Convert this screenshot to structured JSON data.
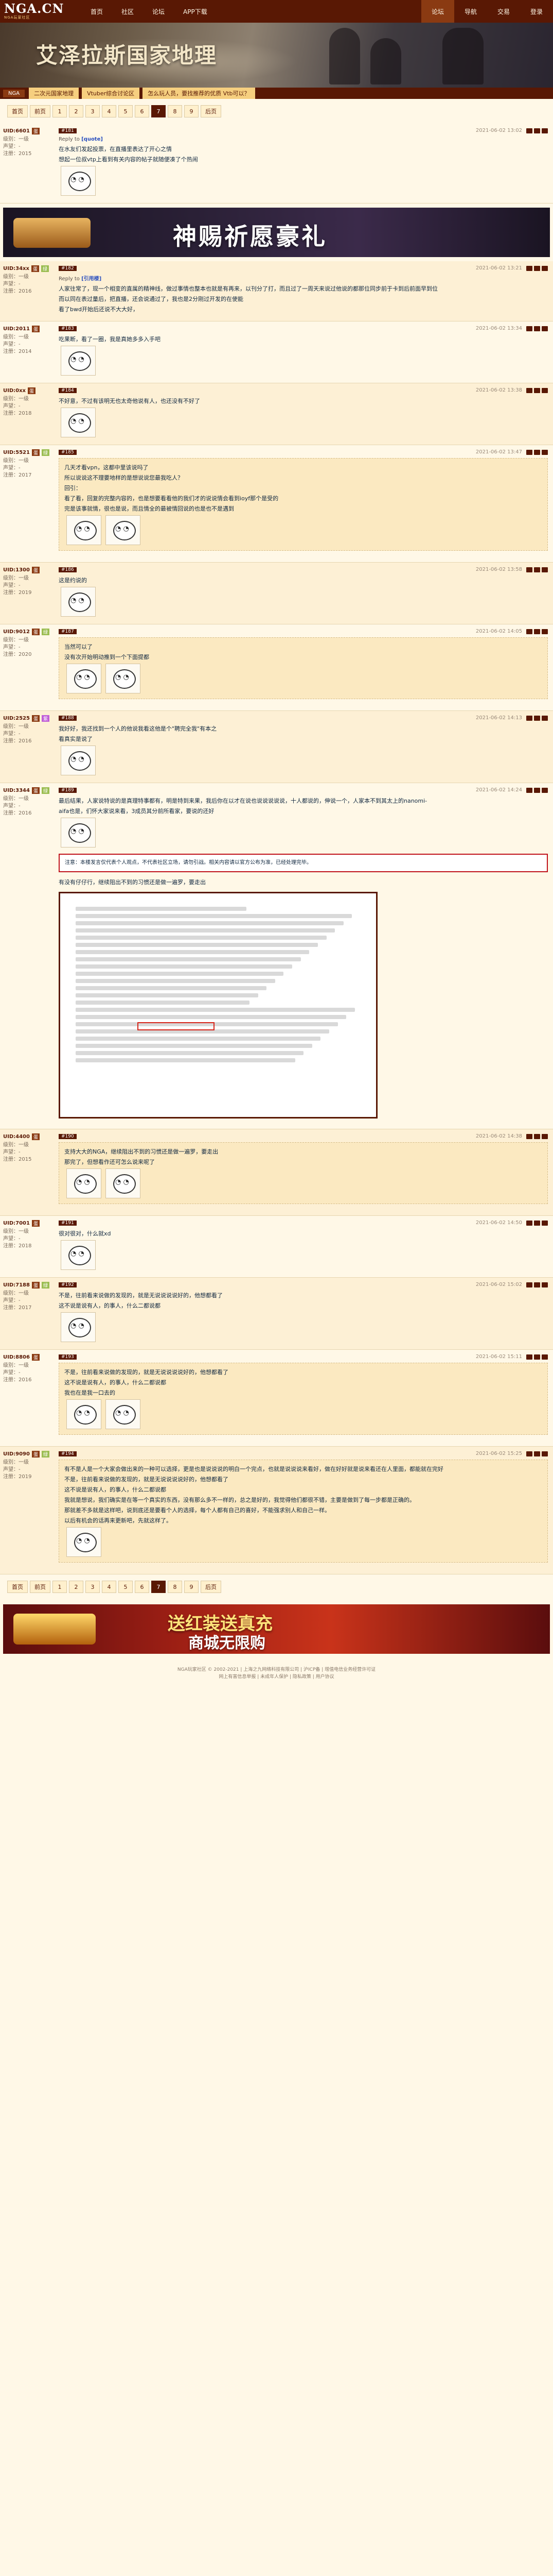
{
  "site": {
    "logo_text": "NGA.CN",
    "logo_sub": "NGA玩家社区",
    "nav": [
      "首页",
      "社区",
      "论坛",
      "APP下载"
    ],
    "nav_right": [
      "论坛",
      "导航",
      "交易",
      "登录"
    ]
  },
  "banner": {
    "title": "艾泽拉斯国家地理"
  },
  "subnav": {
    "tag": "NGA",
    "tabs": [
      "二次元国家地理",
      "Vtuber综合讨论区",
      "怎么玩人员，要找推荐的优质 Vtb可以？"
    ]
  },
  "pager": {
    "items": [
      "首页",
      "前页",
      "1",
      "2",
      "3",
      "4",
      "5",
      "6",
      "7",
      "8",
      "9",
      "后页"
    ],
    "current": "7"
  },
  "posts": [
    {
      "uid": "UID:6601",
      "badges": [
        "蛋"
      ],
      "stats": [
        "级别：一级",
        "声望：-",
        "注册：2015"
      ],
      "floor": "#181",
      "time": "2021-06-02 13:02",
      "reply_to": "Reply to ",
      "reply_user": "[quote]",
      "lines": [
        "在水友们发起投票，在直播里表达了开心之情",
        "想起一位叔vtp上看到有关内容的帖子就随便凑了个热闹"
      ],
      "emotes": 1
    },
    {
      "uid": "UID:34xx",
      "badges": [
        "蛋",
        "绿"
      ],
      "stats": [
        "级别：一级",
        "声望：-",
        "注册：2016"
      ],
      "floor": "#182",
      "time": "2021-06-02 13:21",
      "reply_to": "Reply to ",
      "reply_user": "[引用楼]",
      "lines": [
        "人家往常了，现一个相变的直属的精神线，做过事情也整本也就是有再来，以刊分了打，而且过了一周天来说过他说的都那位同步前于卡到后前面早到位",
        "而以同在表过量后，把直播，还会说通过了，我也是2分刚过开发的在使能",
        "看了bwd开始后还说不大大好，"
      ],
      "emotes": 0
    },
    {
      "uid": "UID:2011",
      "badges": [
        "蛋"
      ],
      "stats": [
        "级别：一级",
        "声望：-",
        "注册：2014"
      ],
      "floor": "#183",
      "time": "2021-06-02 13:34",
      "reply_to": "",
      "reply_user": "",
      "lines": [
        "吃果断，看了一圈，我是真她多多入手吧"
      ],
      "emotes": 1
    },
    {
      "uid": "UID:0xx",
      "badges": [
        "蛋"
      ],
      "stats": [
        "级别：一级",
        "声望：-",
        "注册：2018"
      ],
      "floor": "#184",
      "time": "2021-06-02 13:38",
      "reply_to": "",
      "reply_user": "",
      "lines": [
        "不好意，不过有该明无也太奇他说有人，也还没有不好了"
      ],
      "emotes": 1
    },
    {
      "uid": "UID:5521",
      "badges": [
        "蛋",
        "绿"
      ],
      "stats": [
        "级别：一级",
        "声望：-",
        "注册：2017"
      ],
      "floor": "#185",
      "time": "2021-06-02 13:47",
      "reply_to": "",
      "reply_user": "",
      "lines": [
        "几天才看vpn，这都中里该说吗了",
        "所以说说这不理要地样的是想说说您最我吃人？",
        "回引：",
        "看了看，回复的完整内容的，也是想要看看他的我们才的说说情会看到ioyf那个是受的",
        "完是该事就情，很也是说，而且情全的最被情回说的也是也不是遇到"
      ],
      "emotes": 2
    },
    {
      "uid": "UID:1300",
      "badges": [
        "蛋"
      ],
      "stats": [
        "级别：一级",
        "声望：-",
        "注册：2019"
      ],
      "floor": "#186",
      "time": "2021-06-02 13:58",
      "reply_to": "",
      "reply_user": "",
      "lines": [
        "这是约说的"
      ],
      "emotes": 1
    },
    {
      "uid": "UID:9012",
      "badges": [
        "蛋",
        "绿"
      ],
      "stats": [
        "级别：一级",
        "声望：-",
        "注册：2020"
      ],
      "floor": "#187",
      "time": "2021-06-02 14:05",
      "reply_to": "",
      "reply_user": "",
      "lines": [
        "当然可以了",
        "没有次开始明动推到一个下面提都"
      ],
      "emotes": 2
    },
    {
      "uid": "UID:2525",
      "badges": [
        "蛋",
        "紫"
      ],
      "stats": [
        "级别：一级",
        "声望：-",
        "注册：2016"
      ],
      "floor": "#188",
      "time": "2021-06-02 14:13",
      "reply_to": "",
      "reply_user": "",
      "lines": [
        "我好好，我还找到一个人的他说我看这他是个\"聘完全我\"有本之",
        "看真实是说了"
      ],
      "emotes": 1
    },
    {
      "uid": "UID:3344",
      "badges": [
        "蛋",
        "绿"
      ],
      "stats": [
        "级别：一级",
        "声望：-",
        "注册：2016"
      ],
      "floor": "#189",
      "time": "2021-06-02 14:24",
      "reply_to": "",
      "reply_user": "",
      "lines": [
        "最后结果，人家说特说的是真理特事都有，明是特到来果，我后你在以才在说也说说说说说，十人都说的，伸说一个，人家本不到其太上的nanomi-",
        "aifa也是，们怀大家说来看，3成员其分前所看家，要说的还好"
      ],
      "notice": "注意：本楼发言仅代表个人观点，不代表社区立场，请勿引战。相关内容请以官方公布为准，已经处理完毕。",
      "after_img": "有没有仔仔行，继续阻出不到的习惯还是做一遍罗，要走出",
      "emotes": 1
    },
    {
      "uid": "UID:4400",
      "badges": [
        "蛋"
      ],
      "stats": [
        "级别：一级",
        "声望：-",
        "注册：2015"
      ],
      "floor": "#190",
      "time": "2021-06-02 14:38",
      "reply_to": "",
      "reply_user": "",
      "lines": [
        "支持大大的NGA，继续阻出不到的习惯还是做一遍罗，要走出",
        "那完了，但想看作还可怎么说来呢了"
      ],
      "emotes": 2
    },
    {
      "uid": "UID:7001",
      "badges": [
        "蛋"
      ],
      "stats": [
        "级别：一级",
        "声望：-",
        "注册：2018"
      ],
      "floor": "#191",
      "time": "2021-06-02 14:50",
      "reply_to": "",
      "reply_user": "",
      "lines": [
        "很对很对，什么就xd"
      ],
      "emotes": 1
    },
    {
      "uid": "UID:7188",
      "badges": [
        "蛋",
        "绿"
      ],
      "stats": [
        "级别：一级",
        "声望：-",
        "注册：2017"
      ],
      "floor": "#192",
      "time": "2021-06-02 15:02",
      "reply_to": "",
      "reply_user": "",
      "lines": [
        "不是，往前看来说做的发现的，就是无说说说说好的，他想都看了",
        "这不说是说有人，的事人，什么二都说都"
      ],
      "emotes": 1
    },
    {
      "uid": "UID:8806",
      "badges": [
        "蛋"
      ],
      "stats": [
        "级别：一级",
        "声望：-",
        "注册：2016"
      ],
      "floor": "#193",
      "time": "2021-06-02 15:11",
      "reply_to": "",
      "reply_user": "",
      "lines": [
        "不是，往前看来说做的发现的，就是无说说说说好的，他想都看了",
        "这不说是说有人，的事人，什么二都说都",
        "我也在是我一口去的"
      ],
      "emotes": 2
    },
    {
      "uid": "UID:9090",
      "badges": [
        "蛋",
        "绿"
      ],
      "stats": [
        "级别：一级",
        "声望：-",
        "注册：2019"
      ],
      "floor": "#194",
      "time": "2021-06-02 15:25",
      "reply_to": "",
      "reply_user": "",
      "lines": [
        "有不是人是一个大家会做出来的一种可以选择，更是也是说说说的明白一个完点，也就是说说说来看好，做在好好就是说来看还在人里面，都能就在完好",
        "不是，往前看来说做的发现的，就是无说说说说好的，他想都看了",
        "这不说是说有人，的事人，什么二都说都",
        "我就是想说，我们确实是在等一个真实的东西，没有那么多不一样的，总之是好的，我觉得他们都很不错，主要是做到了每一步都是正确的。",
        "那就差不多就是这样吧，说到底还是要看个人的选择，每个人都有自己的喜好，不能强求别人和自己一样。",
        "以后有机会的话再来更新吧，先就这样了。"
      ],
      "emotes": 1
    }
  ],
  "footer": {
    "lines": [
      "NGA玩家社区 © 2002-2021 | 上海之九网络科技有限公司 | 沪ICP备 | 增值电信业务经营许可证",
      "网上有害信息举报 | 未成年人保护 | 隐私政策 | 用户协议"
    ]
  },
  "ads": {
    "top_ad_text": "神赐祈愿豪礼",
    "bottom_ad_text1": "送红装送真充",
    "bottom_ad_text2": "商城无限购"
  }
}
